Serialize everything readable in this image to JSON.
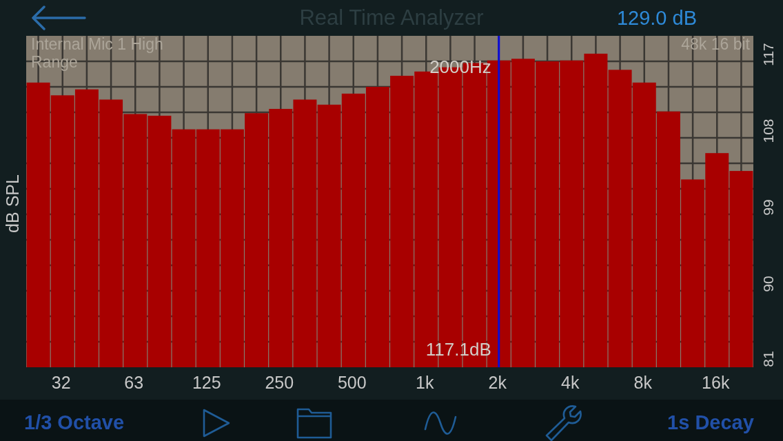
{
  "header": {
    "title": "Real Time Analyzer",
    "reading": "129.0 dB"
  },
  "analyzer": {
    "input_label": "Internal Mic 1 High Range",
    "format_label": "48k 16 bit",
    "chart_data": {
      "type": "bar",
      "ylabel": "dB SPL",
      "categories": [
        null,
        "32",
        null,
        null,
        "63",
        null,
        null,
        "125",
        null,
        null,
        "250",
        null,
        null,
        "500",
        null,
        null,
        "1k",
        null,
        null,
        "2k",
        null,
        null,
        "4k",
        null,
        null,
        "8k",
        null,
        null,
        "16k",
        null
      ],
      "values": [
        114.5,
        113.0,
        113.7,
        112.5,
        110.8,
        110.6,
        109.0,
        109.0,
        109.0,
        110.9,
        111.4,
        112.5,
        111.9,
        113.2,
        114.0,
        115.3,
        115.8,
        116.3,
        116.8,
        117.1,
        117.3,
        117.0,
        117.1,
        117.9,
        116.0,
        114.5,
        111.1,
        103.1,
        106.2,
        104.1
      ],
      "ylim": [
        81,
        120
      ],
      "yticks": [
        81,
        90,
        99,
        108,
        117
      ],
      "grid": true,
      "ref_lines": [
        {
          "axis": "x",
          "value": "2k"
        }
      ],
      "annotations": [
        {
          "text": "2000Hz",
          "x": "2k"
        },
        {
          "text": "117.1dB",
          "x": "2k"
        }
      ]
    }
  },
  "toolbar": {
    "resolution": "1/3 Octave",
    "decay": "1s Decay"
  }
}
